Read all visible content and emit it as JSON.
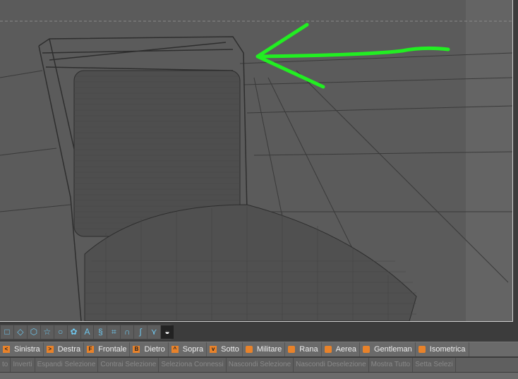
{
  "toolbar_icons": [
    "square",
    "diamond",
    "hexagon",
    "star",
    "circle",
    "flower",
    "text-a",
    "helix",
    "bracket",
    "arc",
    "curve",
    "chevron",
    "half-sphere"
  ],
  "camera_views": [
    {
      "label": "Sinistra",
      "icon": "left-arrow-icon",
      "glyph": "<"
    },
    {
      "label": "Destra",
      "icon": "right-arrow-icon",
      "glyph": ">"
    },
    {
      "label": "Frontale",
      "icon": "front-icon",
      "glyph": "F"
    },
    {
      "label": "Dietro",
      "icon": "back-icon",
      "glyph": "B"
    },
    {
      "label": "Sopra",
      "icon": "up-icon",
      "glyph": "^"
    },
    {
      "label": "Sotto",
      "icon": "down-icon",
      "glyph": "v"
    },
    {
      "label": "Militare",
      "icon": "cube-icon",
      "glyph": ""
    },
    {
      "label": "Rana",
      "icon": "cube-icon",
      "glyph": ""
    },
    {
      "label": "Aerea",
      "icon": "cube-icon",
      "glyph": ""
    },
    {
      "label": "Gentleman",
      "icon": "cube-icon",
      "glyph": ""
    },
    {
      "label": "Isometrica",
      "icon": "cube-icon",
      "glyph": ""
    }
  ],
  "selection_commands": [
    "to",
    "Inverti",
    "Espandi Selezione",
    "Contrai Selezione",
    "Seleziona Connessi",
    "Nascondi Selezione",
    "Nascondi Deselezione",
    "Mostra Tutto",
    "Setta Selezi"
  ],
  "colors": {
    "annotation_arrow": "#22ee22",
    "accent": "#e8822a"
  }
}
